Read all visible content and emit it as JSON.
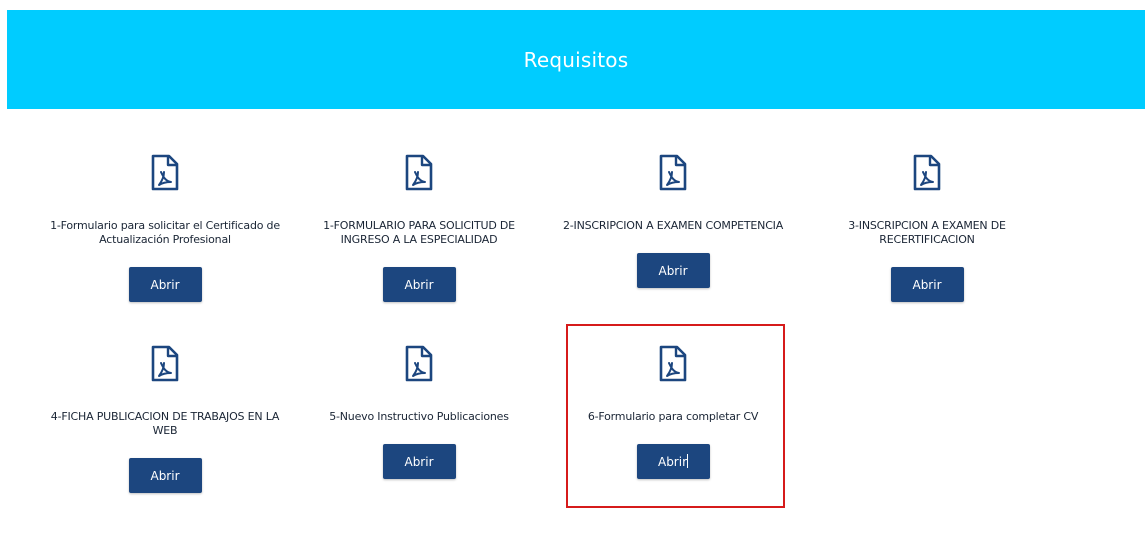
{
  "header": {
    "title": "Requisitos",
    "background_color": "#00ccff"
  },
  "documents": [
    {
      "label": "1-Formulario para solicitar el Certificado de Actualización Profesional",
      "button_label": "Abrir",
      "icon": "pdf-file-icon"
    },
    {
      "label": "1-FORMULARIO PARA SOLICITUD DE INGRESO A LA ESPECIALIDAD",
      "button_label": "Abrir",
      "icon": "pdf-file-icon"
    },
    {
      "label": "2-INSCRIPCION A EXAMEN COMPETENCIA",
      "button_label": "Abrir",
      "icon": "pdf-file-icon"
    },
    {
      "label": "3-INSCRIPCION A EXAMEN DE RECERTIFICACION",
      "button_label": "Abrir",
      "icon": "pdf-file-icon"
    },
    {
      "label": "4-FICHA PUBLICACION DE TRABAJOS EN LA WEB",
      "button_label": "Abrir",
      "icon": "pdf-file-icon"
    },
    {
      "label": "5-Nuevo Instructivo Publicaciones",
      "button_label": "Abrir",
      "icon": "pdf-file-icon"
    },
    {
      "label": "6-Formulario para completar CV",
      "button_label": "Abrir",
      "icon": "pdf-file-icon"
    }
  ],
  "colors": {
    "button": "#1c467f",
    "icon": "#1c467f",
    "highlight": "#d61b1b"
  }
}
